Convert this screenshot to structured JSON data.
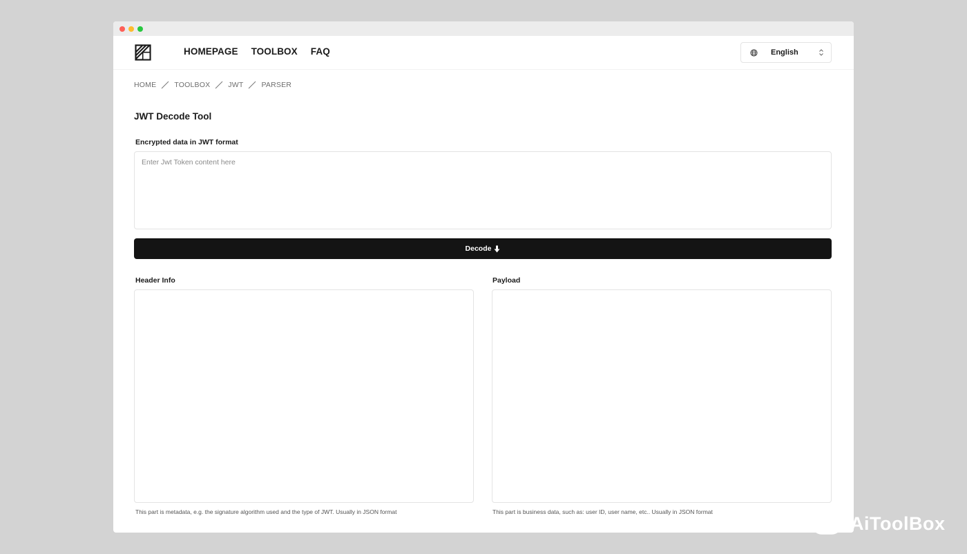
{
  "nav": {
    "links": [
      "HOMEPAGE",
      "TOOLBOX",
      "FAQ"
    ],
    "language": "English"
  },
  "breadcrumb": [
    "HOME",
    "TOOLBOX",
    "JWT",
    "PARSER"
  ],
  "page": {
    "title": "JWT Decode Tool"
  },
  "input": {
    "label": "Encrypted data in JWT format",
    "placeholder": "Enter Jwt Token content here",
    "value": ""
  },
  "decode_button": {
    "label": "Decode"
  },
  "header_panel": {
    "label": "Header Info",
    "value": "",
    "hint": "This part is metadata, e.g. the signature algorithm used and the type of JWT. Usually in JSON format"
  },
  "payload_panel": {
    "label": "Payload",
    "value": "",
    "hint": "This part is business data, such as: user ID, user name, etc.. Usually in JSON format"
  },
  "watermark": {
    "text": "AiToolBox"
  },
  "icons": {
    "logo": "toolbox-logo-icon",
    "language": "globe-icon",
    "select": "chevron-updown-icon",
    "decode": "arrow-down-icon"
  },
  "colors": {
    "primary_button": "#141414",
    "border": "#e3e3e3",
    "background": "#d3d3d3"
  }
}
